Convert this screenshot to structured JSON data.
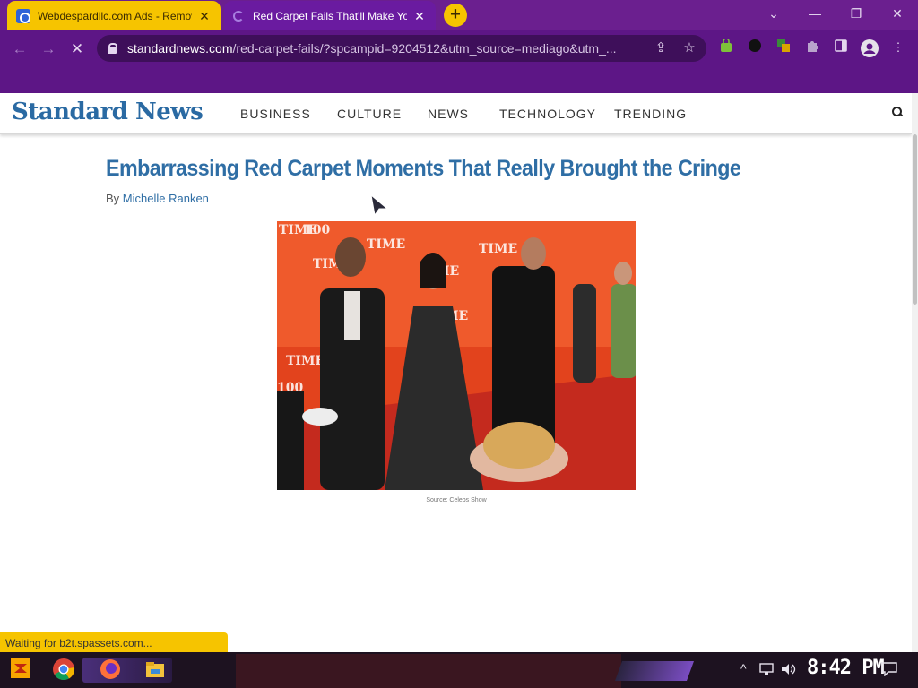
{
  "browser": {
    "tabs": [
      {
        "title": "Webdespardllc.com Ads - Remove",
        "close": "✕",
        "state": "inactive"
      },
      {
        "title": "Red Carpet Fails That'll Make You",
        "close": "✕",
        "state": "active-loading"
      }
    ],
    "new_tab": "+",
    "window_controls": {
      "dropdown": "⌄",
      "minimize": "—",
      "restore": "❐",
      "close": "✕"
    },
    "nav": {
      "back": "←",
      "forward": "→",
      "stop": "✕"
    },
    "address_bar": {
      "host": "standardnews.com",
      "path": "/red-carpet-fails/?spcampid=9204512&utm_source=mediago&utm_..."
    },
    "colors": {
      "frame": "#5d1686",
      "tab_inactive": "#f6c400"
    }
  },
  "site": {
    "logo": "Standard News",
    "nav": [
      "BUSINESS",
      "CULTURE",
      "NEWS",
      "TECHNOLOGY",
      "TRENDING"
    ],
    "colors": {
      "brand": "#2a6aa3"
    }
  },
  "article": {
    "headline": "Embarrassing Red Carpet Moments That Really Brought the Cringe",
    "byline_prefix": "By",
    "author": "Michelle Ranken",
    "image_caption": "Source: Celebs Show",
    "image_text": [
      "TIME",
      "100"
    ]
  },
  "status_bubble": "Waiting for b2t.spassets.com...",
  "taskbar": {
    "clock": "8:42 PM",
    "tray_icons": [
      "chevron-up-icon",
      "network-icon",
      "volume-icon",
      "notification-icon"
    ]
  }
}
